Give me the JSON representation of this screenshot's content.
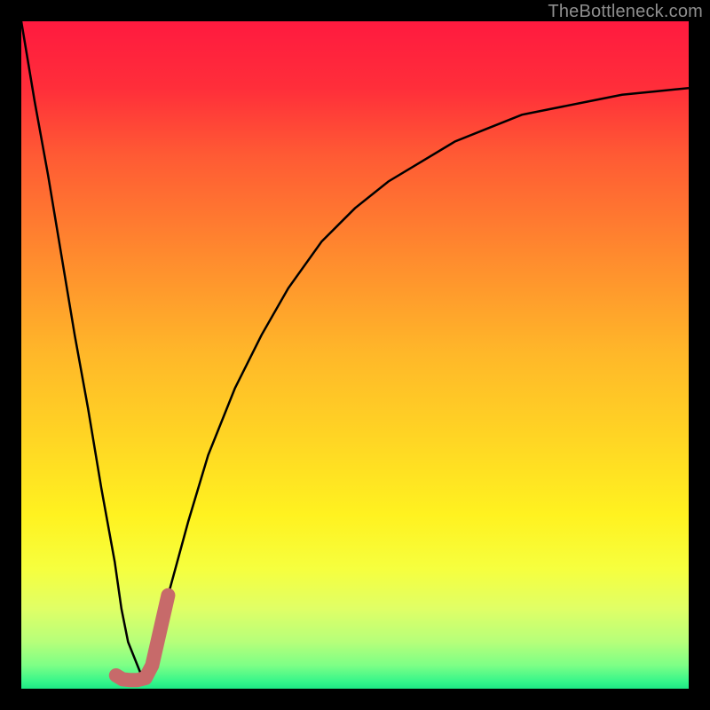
{
  "watermark": "TheBottleneck.com",
  "gradient": {
    "stops": [
      {
        "offset": 0.0,
        "color": "#ff1a3f"
      },
      {
        "offset": 0.1,
        "color": "#ff2e3a"
      },
      {
        "offset": 0.2,
        "color": "#ff5a34"
      },
      {
        "offset": 0.35,
        "color": "#ff8a2e"
      },
      {
        "offset": 0.5,
        "color": "#ffb829"
      },
      {
        "offset": 0.62,
        "color": "#ffd424"
      },
      {
        "offset": 0.74,
        "color": "#fff220"
      },
      {
        "offset": 0.82,
        "color": "#f6ff3e"
      },
      {
        "offset": 0.88,
        "color": "#e0ff66"
      },
      {
        "offset": 0.93,
        "color": "#b6ff7a"
      },
      {
        "offset": 0.965,
        "color": "#7dff86"
      },
      {
        "offset": 0.99,
        "color": "#34f58a"
      },
      {
        "offset": 1.0,
        "color": "#1de885"
      }
    ]
  },
  "chart_data": {
    "type": "line",
    "title": "",
    "xlabel": "",
    "ylabel": "",
    "xlim": [
      0,
      100
    ],
    "ylim": [
      0,
      100
    ],
    "grid": false,
    "legend": false,
    "series": [
      {
        "name": "bottleneck-curve",
        "x": [
          0,
          2,
          4,
          6,
          8,
          10,
          12,
          14,
          15,
          16,
          18,
          20,
          22,
          25,
          28,
          32,
          36,
          40,
          45,
          50,
          55,
          60,
          65,
          70,
          75,
          80,
          85,
          90,
          95,
          100
        ],
        "y": [
          100,
          88,
          77,
          65,
          53,
          42,
          30,
          19,
          12,
          7,
          2,
          6,
          14,
          25,
          35,
          45,
          53,
          60,
          67,
          72,
          76,
          79,
          82,
          84,
          86,
          87,
          88,
          89,
          89.5,
          90
        ],
        "stroke": "#000000",
        "stroke_width": 2.5
      },
      {
        "name": "marker-j",
        "x": [
          14.2,
          15.2,
          16.2,
          17.4,
          18.6,
          19.6,
          20.4,
          21.2,
          22.0
        ],
        "y": [
          2.0,
          1.4,
          1.3,
          1.3,
          1.6,
          3.5,
          7.0,
          10.5,
          14.0
        ],
        "stroke": "#c76a6a",
        "stroke_width": 16,
        "linecap": "round"
      }
    ]
  }
}
